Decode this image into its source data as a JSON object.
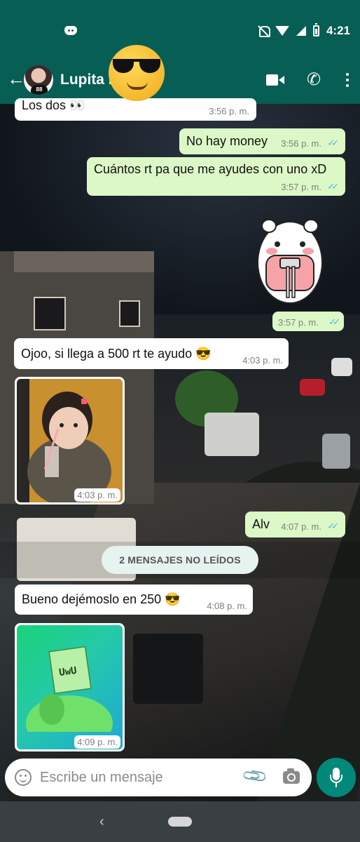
{
  "status_bar": {
    "time": "4:21"
  },
  "header": {
    "contact_name": "Lupita L          d Bs"
  },
  "messages": [
    {
      "dir": "in",
      "text": "Los dos 👀",
      "time": "3:56 p. m."
    },
    {
      "dir": "out",
      "text": "No hay money",
      "time": "3:56 p. m."
    },
    {
      "dir": "out",
      "text": "Cuántos rt pa que me ayudes con uno xD",
      "time": "3:57 p. m."
    },
    {
      "dir": "out",
      "type": "sticker",
      "time": "3:57 p. m."
    },
    {
      "dir": "in",
      "text": "Ojoo, si llega a 500 rt te ayudo 😎",
      "time": "4:03 p. m."
    },
    {
      "dir": "in",
      "type": "image",
      "time": "4:03 p. m."
    },
    {
      "dir": "out",
      "text": "Alv",
      "time": "4:07 p. m."
    },
    {
      "dir": "in",
      "text": "Bueno dejémoslo en 250 😎",
      "time": "4:08 p. m."
    },
    {
      "dir": "in",
      "type": "image",
      "image_text": "UwU",
      "time": "4:09 p. m."
    }
  ],
  "unread_banner": "2 MENSAJES NO LEÍDOS",
  "composer": {
    "placeholder": "Escribe un mensaje"
  },
  "colors": {
    "header": "#075e54",
    "outgoing": "#dcf8c6",
    "incoming": "#ffffff",
    "mic": "#00897b",
    "ticks": "#4fb6ec"
  },
  "icons": [
    "discord-icon",
    "mute-icon",
    "wifi-icon",
    "signal-icon",
    "battery-icon",
    "back-arrow-icon",
    "video-call-icon",
    "phone-icon",
    "menu-icon",
    "emoji-icon",
    "attach-icon",
    "camera-icon",
    "mic-icon",
    "nav-back-icon",
    "nav-home-icon"
  ]
}
